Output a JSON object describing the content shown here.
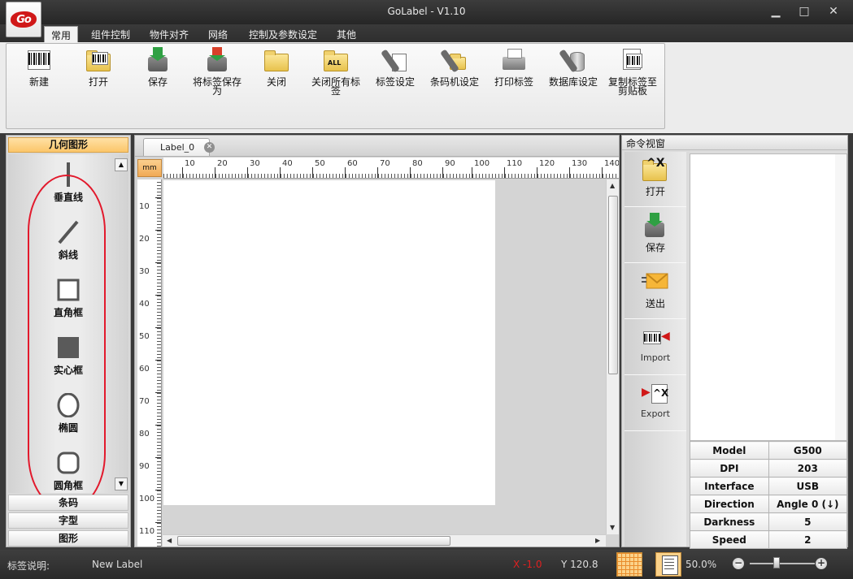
{
  "window": {
    "title": "GoLabel - V1.10",
    "logo_text": "Go",
    "controls": {
      "minimize": "▁",
      "maximize": "□",
      "close": "✕"
    }
  },
  "menu_tabs": [
    "常用",
    "组件控制",
    "物件对齐",
    "网络",
    "控制及参数设定",
    "其他"
  ],
  "ribbon": {
    "new": "新建",
    "open": "打开",
    "save": "保存",
    "save_as": "将标签保存为",
    "close": "关闭",
    "close_all": "关闭所有标签",
    "close_all_badge": "ALL",
    "label_setup": "标签设定",
    "printer_setup": "条码机设定",
    "print_label": "打印标签",
    "database_setup": "数据库设定",
    "copy_clipboard": "复制标签至剪贴板"
  },
  "left_panel": {
    "header": "几何图形",
    "tools": [
      "垂直线",
      "斜线",
      "直角框",
      "实心框",
      "椭圆",
      "圆角框"
    ],
    "categories": [
      "条码",
      "字型",
      "图形"
    ]
  },
  "editor": {
    "tab_label": "Label_0",
    "unit": "mm",
    "ruler_h": [
      "10",
      "20",
      "30",
      "40",
      "50",
      "60",
      "70",
      "80",
      "90",
      "100",
      "110",
      "120",
      "130",
      "140"
    ],
    "ruler_v": [
      "10",
      "20",
      "30",
      "40",
      "50",
      "60",
      "70",
      "80",
      "90",
      "100",
      "110"
    ]
  },
  "right_panel": {
    "header": "命令视窗",
    "commands": {
      "open": "打开",
      "save": "保存",
      "send": "送出",
      "import": "Import",
      "export": "Export"
    },
    "info": [
      {
        "key": "Model",
        "value": "G500"
      },
      {
        "key": "DPI",
        "value": "203"
      },
      {
        "key": "Interface",
        "value": "USB"
      },
      {
        "key": "Direction",
        "value": "Angle 0 (↓)"
      },
      {
        "key": "Darkness",
        "value": "5"
      },
      {
        "key": "Speed",
        "value": "2"
      }
    ]
  },
  "status": {
    "desc_label": "标签说明:",
    "desc_value": "New Label",
    "x": "X -1.0",
    "y": "Y 120.8",
    "zoom": "50.0%",
    "zoom_minus": "−",
    "zoom_plus": "+"
  },
  "colors": {
    "accent_orange": "#fbc66a",
    "highlight_red": "#e2192c",
    "coord_x_red": "#e02020"
  }
}
